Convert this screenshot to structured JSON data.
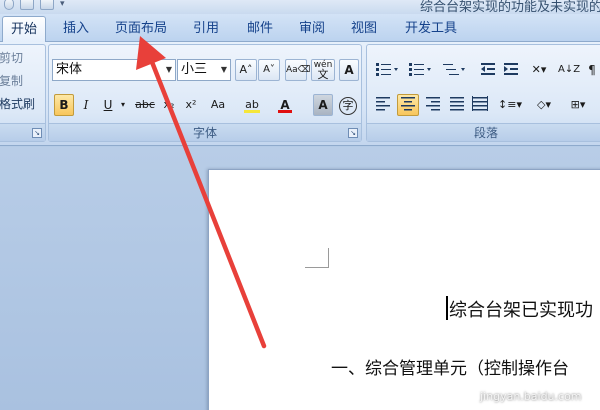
{
  "title": "综合台架实现的功能及未实现的功",
  "tabs": [
    "开始",
    "插入",
    "页面布局",
    "引用",
    "邮件",
    "审阅",
    "视图",
    "开发工具"
  ],
  "clipboard": {
    "cut": "剪切",
    "copy": "复制",
    "format_painter": "格式刷"
  },
  "font": {
    "name": "宋体",
    "size": "小三",
    "grow_label": "A˄",
    "shrink_label": "A˅",
    "wen_label": "wén",
    "bold": "B",
    "italic": "I",
    "underline": "U",
    "strike": "abc",
    "sub": "x₂",
    "sup": "x²",
    "case": "Aa",
    "highlight_label": "ab",
    "font_color_label": "A",
    "shade_label": "A",
    "char_border_label": "A",
    "enclose_label": "字",
    "group_label": "字体",
    "highlight_color": "#f5e63a",
    "font_color": "#e01010"
  },
  "paragraph": {
    "group_label": "段落"
  },
  "document": {
    "heading": "综合台架已实现功",
    "line1": "一、综合管理单元（控制操作台"
  },
  "watermark": "jingyan.baidu.com",
  "annotation": {
    "arrow_color": "#e8403a"
  }
}
